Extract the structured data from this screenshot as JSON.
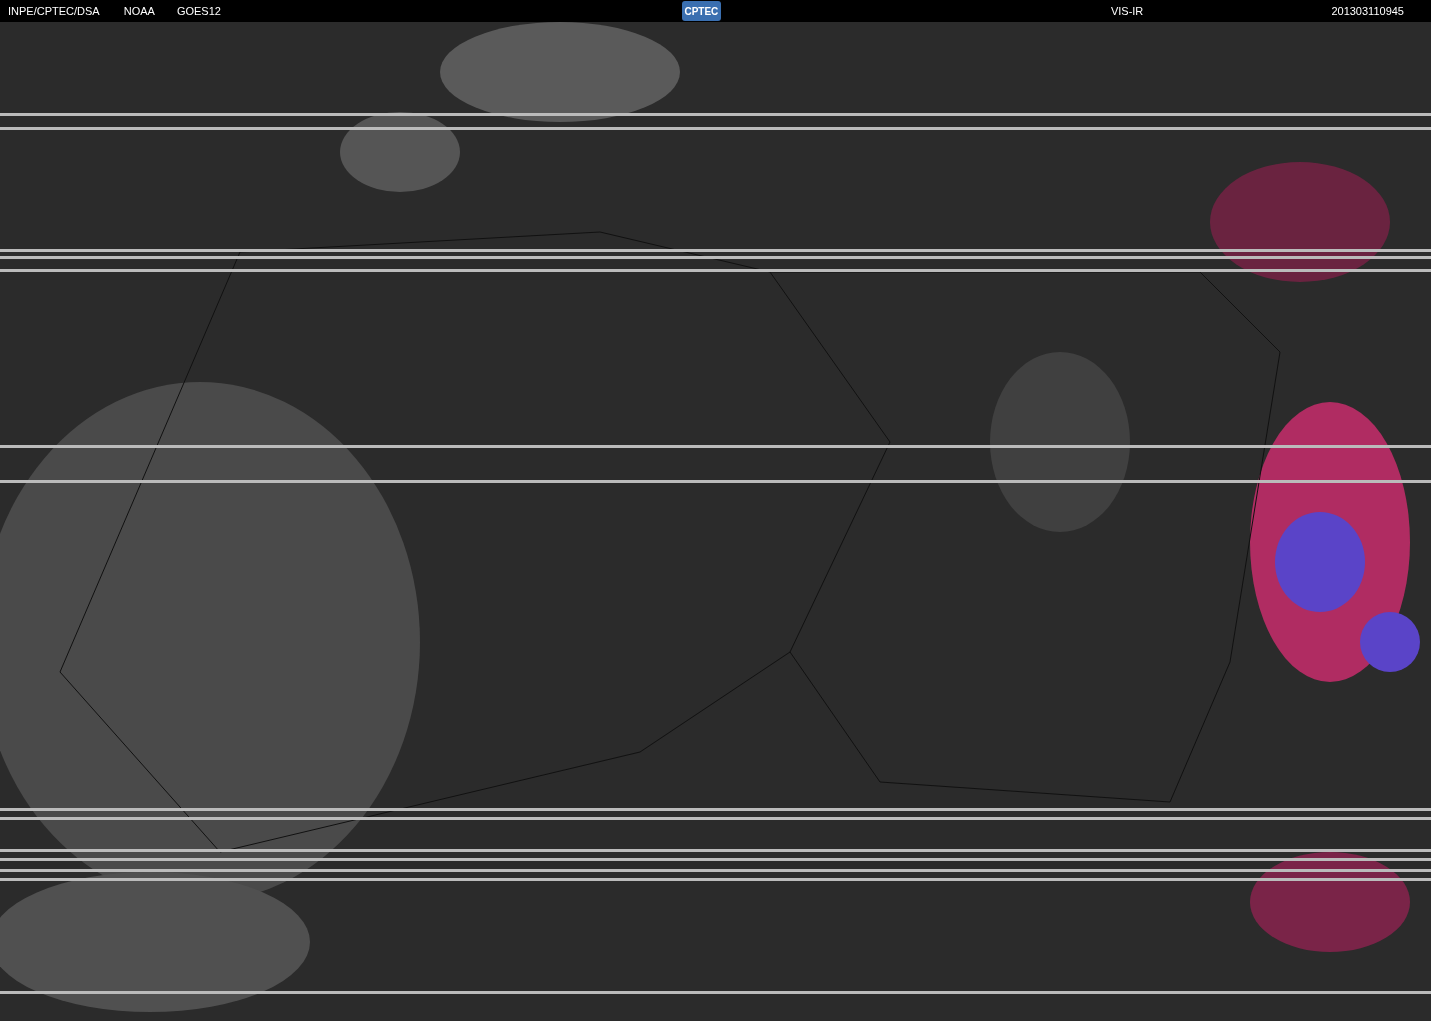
{
  "header": {
    "source": "INPE/CPTEC/DSA",
    "agency": "NOAA",
    "satellite": "GOES12",
    "logo": "CPTEC",
    "channel": "VIS-IR",
    "timestamp": "201303110945"
  }
}
